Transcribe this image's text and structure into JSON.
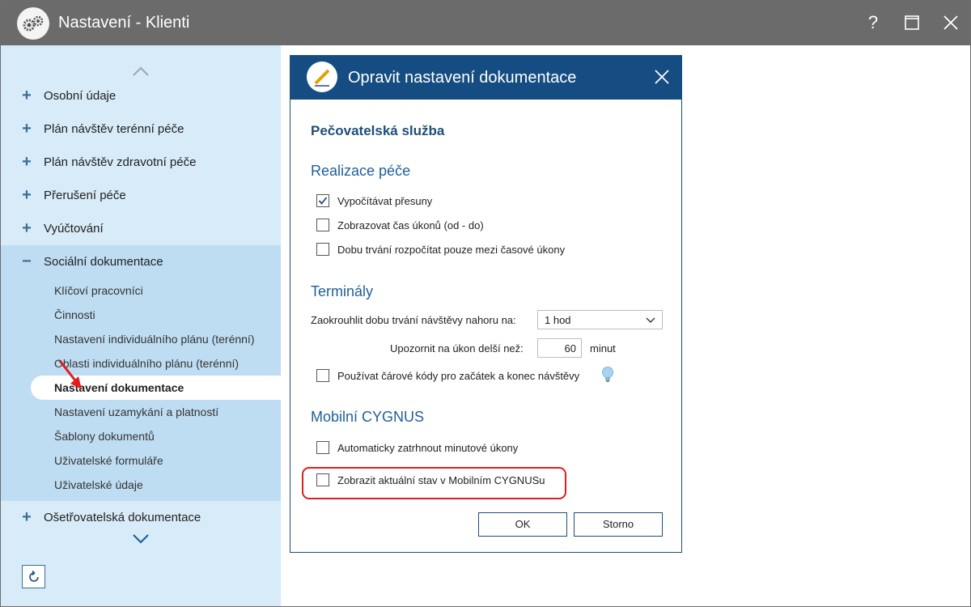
{
  "window": {
    "title": "Nastavení - Klienti",
    "help_label": "?",
    "maximize_icon": "maximize-icon",
    "close_icon": "close-icon"
  },
  "sidebar": {
    "items": [
      {
        "sign": "+",
        "label": "Osobní údaje"
      },
      {
        "sign": "+",
        "label": "Plán návštěv terénní péče"
      },
      {
        "sign": "+",
        "label": "Plán návštěv zdravotní péče"
      },
      {
        "sign": "+",
        "label": "Přerušení péče"
      },
      {
        "sign": "+",
        "label": "Vyúčtování"
      },
      {
        "sign": "−",
        "label": "Sociální dokumentace"
      },
      {
        "sign": "+",
        "label": "Ošetřovatelská dokumentace"
      }
    ],
    "subitems": [
      "Klíčoví pracovníci",
      "Činnosti",
      "Nastavení individuálního plánu (terénní)",
      "Oblasti individuálního plánu (terénní)",
      "Nastavení dokumentace",
      "Nastavení uzamykání a platností",
      "Šablony dokumentů",
      "Uživatelské formuláře",
      "Uživatelské údaje"
    ],
    "active_subitem": "Nastavení dokumentace"
  },
  "dialog": {
    "title": "Opravit nastavení dokumentace",
    "heading": "Pečovatelská služba",
    "sections": {
      "realizace": "Realizace péče",
      "terminaly": "Terminály",
      "mobilni": "Mobilní CYGNUS"
    },
    "checkboxes": {
      "vypocitavat": {
        "label": "Vypočítávat přesuny",
        "checked": true
      },
      "zobrazovat_cas": {
        "label": "Zobrazovat čas úkonů (od - do)",
        "checked": false
      },
      "doba_trvani": {
        "label": "Dobu trvání rozpočítat pouze mezi časové úkony",
        "checked": false
      },
      "carove_kody": {
        "label": "Používat čárové kódy pro začátek a konec návštěvy",
        "checked": false
      },
      "auto_zatrhnout": {
        "label": "Automaticky zatrhnout minutové úkony",
        "checked": false
      },
      "zobrazit_stav": {
        "label": "Zobrazit aktuální stav v Mobilním CYGNUSu",
        "checked": false
      }
    },
    "round_label": "Zaokrouhlit dobu trvání návštěvy nahoru na:",
    "round_value": "1 hod",
    "warn_label": "Upozornit na úkon delší než:",
    "warn_value": "60",
    "warn_unit": "minut",
    "ok_label": "OK",
    "cancel_label": "Storno"
  },
  "colors": {
    "titlebar": "#6b6b6b",
    "dialog_header": "#154d82",
    "sidebar": "#d8ebf8",
    "sidebar_sub": "#bfddf2",
    "highlight": "#e01e1e"
  }
}
